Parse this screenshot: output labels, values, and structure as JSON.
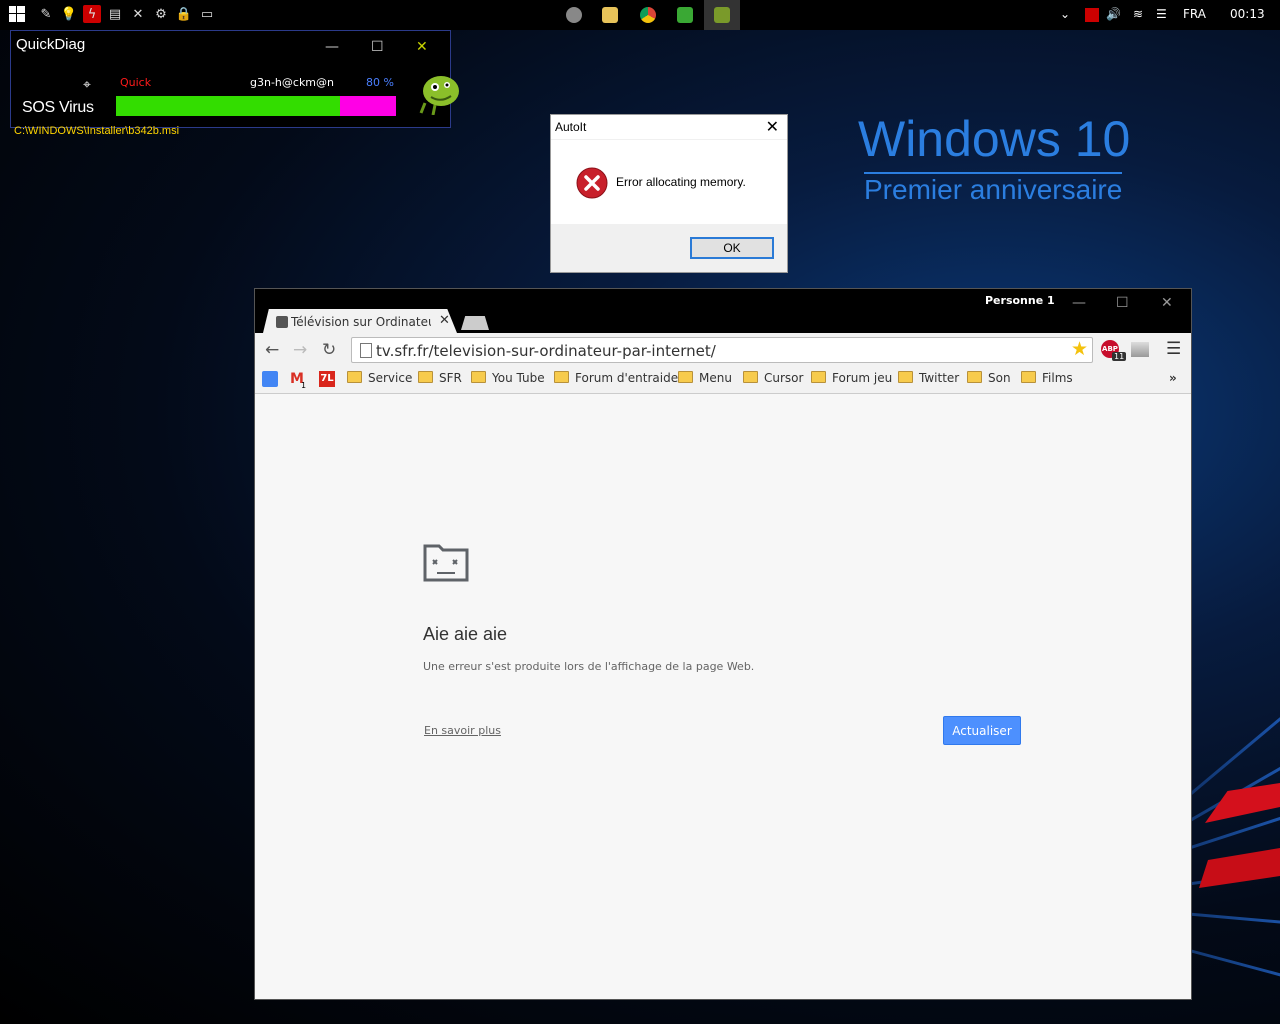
{
  "taskbar": {
    "start_icon": "windows-logo-icon",
    "tray": {
      "language": "FRA",
      "time": "00:13"
    }
  },
  "quickdiag": {
    "title": "QuickDiag",
    "brand": "SOS Virus",
    "mode": "Quick",
    "author": "g3n-h@ckm@n",
    "progress_text": "80 %",
    "progress": 0.8,
    "current_file": "C:\\WINDOWS\\Installer\\b342b.msi",
    "colors": {
      "fill": "#33dd00",
      "remaining": "#ff00e6"
    }
  },
  "autoit": {
    "title": "AutoIt",
    "message": "Error allocating memory.",
    "ok_label": "OK",
    "icon": "error-icon"
  },
  "wallpaper": {
    "title": "Windows 10",
    "subtitle": "Premier anniversaire"
  },
  "browser": {
    "profile": "Personne 1",
    "tab_title": "Télévision sur Ordinateur par Internet",
    "url": "tv.sfr.fr/television-sur-ordinateur-par-internet/",
    "abp_badge": "ABP",
    "abp_count": "11",
    "gmail_count": "1",
    "bookmarks": [
      "Service",
      "SFR",
      "You Tube",
      "Forum d'entraide",
      "Menu",
      "Cursor",
      "Forum jeu",
      "Twitter",
      "Son",
      "Films"
    ],
    "more_bookmarks": "»",
    "error": {
      "title": "Aie aie aie",
      "description": "Une erreur s'est produite lors de l'affichage de la page Web.",
      "learn_more": "En savoir plus",
      "reload_label": "Actualiser"
    }
  }
}
